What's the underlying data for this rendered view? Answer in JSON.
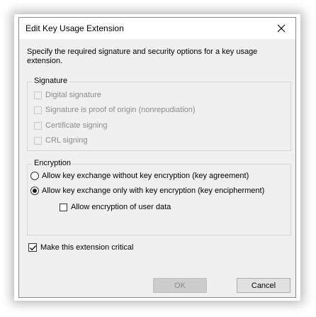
{
  "dialog": {
    "title": "Edit Key Usage Extension",
    "description": "Specify the required signature and security options for a key usage extension."
  },
  "signature": {
    "label": "Signature",
    "options": [
      {
        "label": "Digital signature",
        "checked": false,
        "enabled": false
      },
      {
        "label": "Signature is proof of origin (nonrepudiation)",
        "checked": false,
        "enabled": false
      },
      {
        "label": "Certificate signing",
        "checked": false,
        "enabled": false
      },
      {
        "label": "CRL signing",
        "checked": false,
        "enabled": false
      }
    ]
  },
  "encryption": {
    "label": "Encryption",
    "radio_agreement": {
      "label": "Allow key exchange without key encryption (key agreement)",
      "selected": false
    },
    "radio_encipherment": {
      "label": "Allow key exchange only with key encryption (key encipherment)",
      "selected": true
    },
    "user_data": {
      "label": "Allow encryption of user data",
      "checked": false
    }
  },
  "critical": {
    "label": "Make this extension critical",
    "checked": true
  },
  "buttons": {
    "ok": "OK",
    "cancel": "Cancel"
  }
}
